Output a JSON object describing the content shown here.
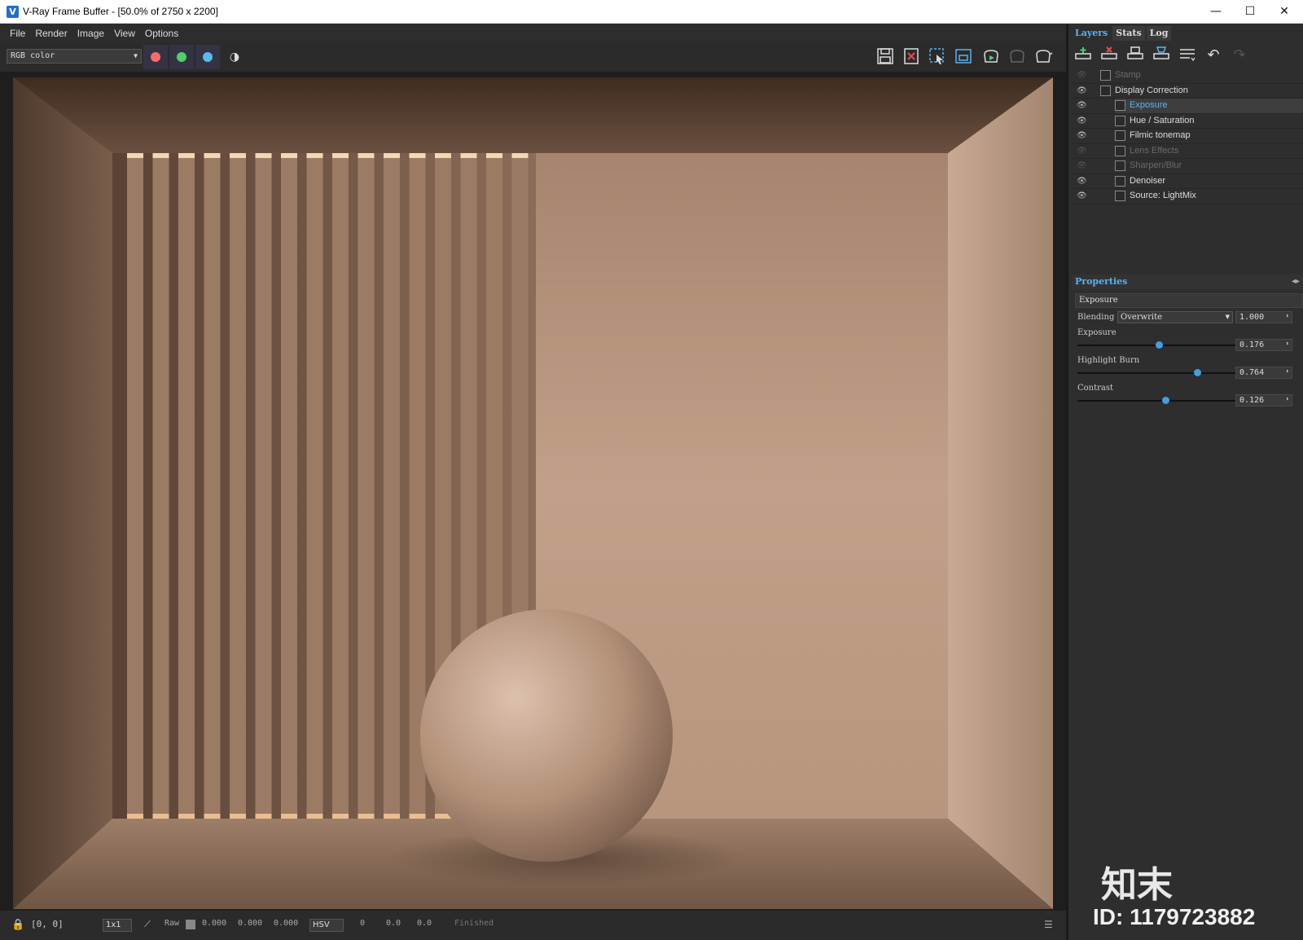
{
  "window": {
    "title": "V-Ray Frame Buffer - [50.0% of 2750 x 2200]",
    "minimize": "—",
    "maximize": "☐",
    "close": "✕"
  },
  "menu": [
    "File",
    "Render",
    "Image",
    "View",
    "Options"
  ],
  "toolbar": {
    "channel": "RGB color",
    "colors": {
      "red": "#ff6a6a",
      "green": "#4ed06a",
      "blue": "#5ab8f0"
    }
  },
  "tabs": [
    "Layers",
    "Stats",
    "Log"
  ],
  "layers": [
    {
      "label": "Stamp",
      "icon": "stamp-icon",
      "enabled": false,
      "indent": 0
    },
    {
      "label": "Display Correction",
      "icon": "display-correction-icon",
      "enabled": true,
      "indent": 0
    },
    {
      "label": "Exposure",
      "icon": "exposure-icon",
      "enabled": true,
      "indent": 1,
      "selected": true
    },
    {
      "label": "Hue / Saturation",
      "icon": "hue-saturation-icon",
      "enabled": true,
      "indent": 1
    },
    {
      "label": "Filmic tonemap",
      "icon": "filmic-tonemap-icon",
      "enabled": true,
      "indent": 1
    },
    {
      "label": "Lens Effects",
      "icon": "lens-effects-icon",
      "enabled": false,
      "indent": 1
    },
    {
      "label": "Sharpen/Blur",
      "icon": "sharpen-blur-icon",
      "enabled": false,
      "indent": 1
    },
    {
      "label": "Denoiser",
      "icon": "denoiser-icon",
      "enabled": true,
      "indent": 1
    },
    {
      "label": "Source: LightMix",
      "icon": "lightmix-icon",
      "enabled": true,
      "indent": 1
    }
  ],
  "properties": {
    "header": "Properties",
    "name": "Exposure",
    "blending_label": "Blending",
    "blending_mode": "Overwrite",
    "blending_value": "1.000",
    "exposure_label": "Exposure",
    "exposure_value": "0.176",
    "exposure_fraction": 0.51,
    "highlight_label": "Highlight Burn",
    "highlight_value": "0.764",
    "highlight_fraction": 0.75,
    "contrast_label": "Contrast",
    "contrast_value": "0.126",
    "contrast_fraction": 0.55
  },
  "status": {
    "coords": "[0, 0]",
    "zoom": "1x1",
    "mode": "Raw",
    "r": "0.000",
    "g": "0.000",
    "b": "0.000",
    "colorspace": "HSV",
    "h": "0",
    "s": "0.0",
    "v": "0.0",
    "state": "Finished"
  },
  "watermark": {
    "brand": "知末",
    "id": "ID: 1179723882"
  }
}
